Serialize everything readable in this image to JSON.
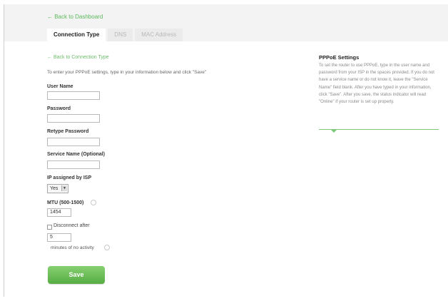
{
  "nav": {
    "back_dashboard": "← Back to Dashboard"
  },
  "tabs": [
    {
      "label": "Connection Type",
      "active": true
    },
    {
      "label": "DNS",
      "active": false
    },
    {
      "label": "MAC Address",
      "active": false
    }
  ],
  "form": {
    "back_connection": "← Back to Connection Type",
    "intro": "To enter your PPPoE settings, type in your information below and click \"Save\"",
    "user_name_label": "User Name",
    "user_name_value": "",
    "password_label": "Password",
    "password_value": "",
    "retype_password_label": "Retype Password",
    "retype_password_value": "",
    "service_name_label": "Service Name (Optional)",
    "service_name_value": "",
    "ip_assigned_label": "IP assigned by ISP",
    "ip_assigned_value": "Yes",
    "mtu_label": "MTU (500-1500)",
    "mtu_value": "1454",
    "disconnect_label": "Disconnect after",
    "disconnect_checked": false,
    "disconnect_value": "5",
    "minutes_label": "minutes of no activity",
    "save_label": "Save"
  },
  "help": {
    "title": "PPPoE Settings",
    "body": "To set the router to use PPPoE, type in the user name and password from your ISP in the spaces provided. If you do not have a service name or do not know it, leave the \"Service Name\" field blank. After you have typed in your information, click \"Save\". After you save, the status indicator will read \"Online\" if your router is set up properly."
  },
  "colors": {
    "accent_green": "#5cb85c",
    "save_button": "#6cbf57"
  },
  "icons": {
    "info": "info-circle-icon",
    "select_arrow": "chevron-down-icon"
  }
}
